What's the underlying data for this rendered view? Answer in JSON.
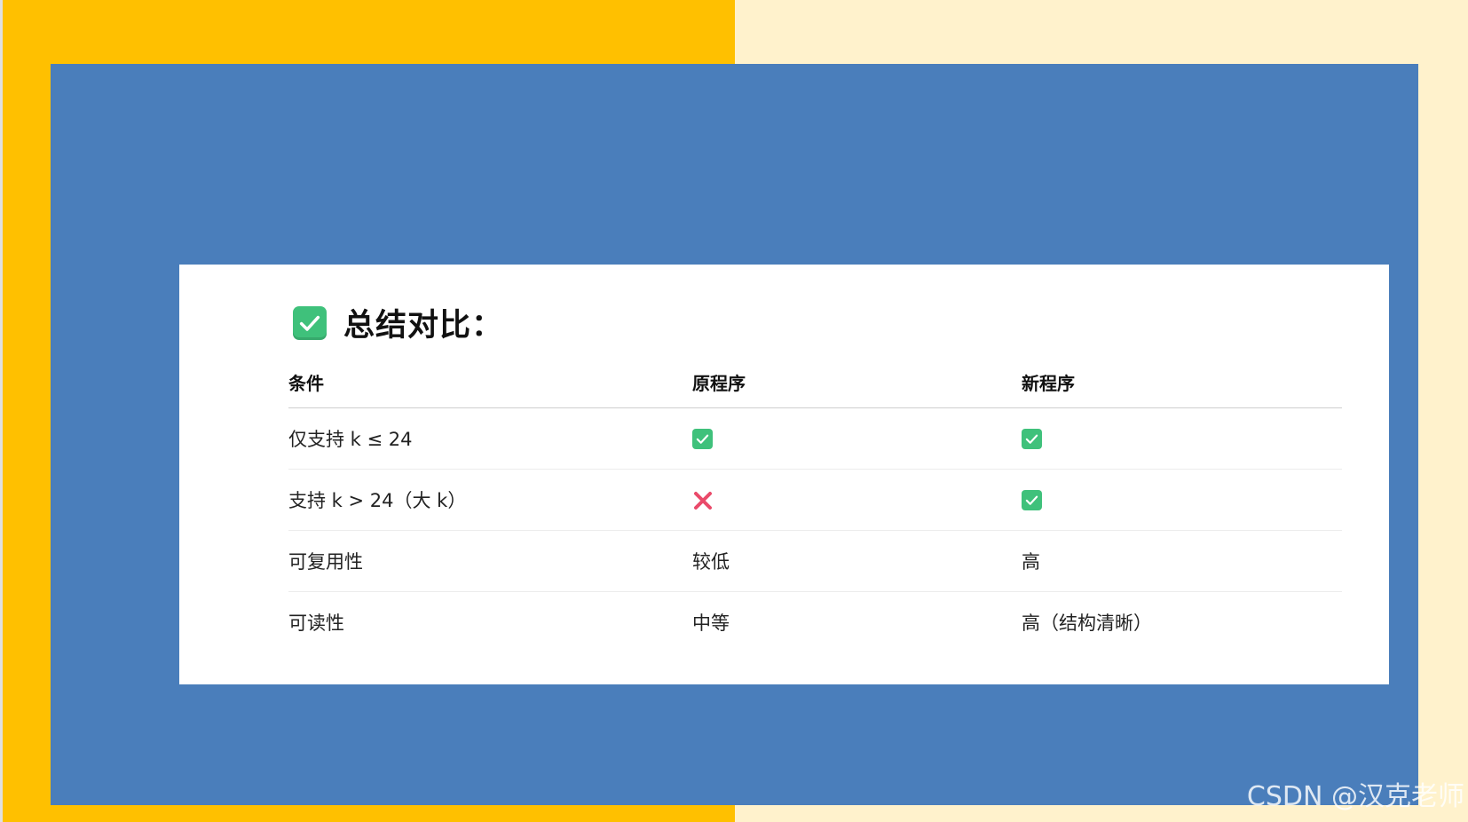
{
  "heading": {
    "icon": "check-box-icon",
    "title": "总结对比："
  },
  "table": {
    "columns": [
      "条件",
      "原程序",
      "新程序"
    ],
    "rows": [
      {
        "condition": "仅支持 k ≤ 24",
        "original": {
          "icon": "check-icon"
        },
        "new": {
          "icon": "check-icon"
        }
      },
      {
        "condition": "支持 k > 24（大 k）",
        "original": {
          "icon": "cross-icon"
        },
        "new": {
          "icon": "check-icon"
        }
      },
      {
        "condition": "可复用性",
        "original": {
          "text": "较低"
        },
        "new": {
          "text": "高"
        }
      },
      {
        "condition": "可读性",
        "original": {
          "text": "中等"
        },
        "new": {
          "text": "高（结构清晰）"
        }
      }
    ]
  },
  "watermark": "CSDN @汉克老师",
  "colors": {
    "left_bg": "#ffc000",
    "right_bg": "#fff2cc",
    "panel": "#4a7ebb",
    "check": "#3fc17b",
    "cross": "#ea4a6a"
  }
}
